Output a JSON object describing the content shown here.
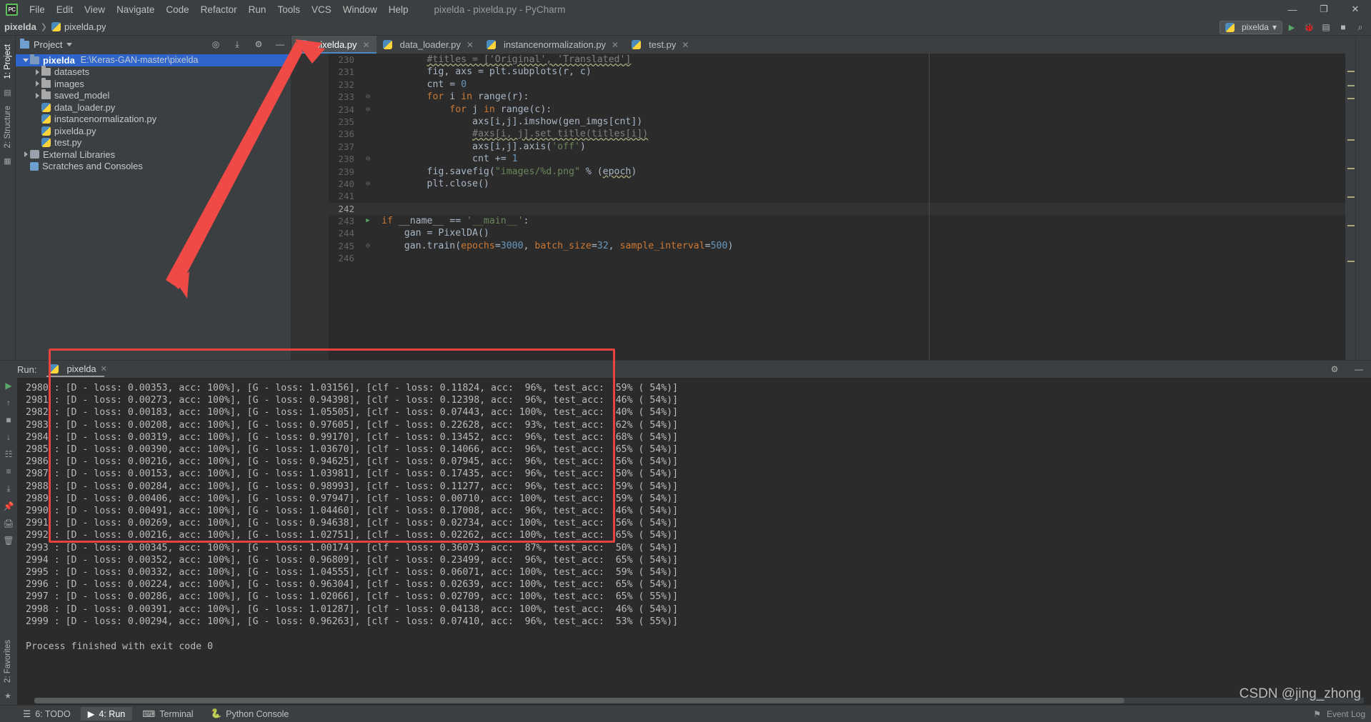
{
  "window": {
    "title": "pixelda - pixelda.py - PyCharm",
    "minimize": "—",
    "maximize": "❐",
    "close": "✕"
  },
  "menu": {
    "items": [
      "File",
      "Edit",
      "View",
      "Navigate",
      "Code",
      "Refactor",
      "Run",
      "Tools",
      "VCS",
      "Window",
      "Help"
    ]
  },
  "breadcrumb": {
    "project": "pixelda",
    "separator": "❯",
    "file": "pixelda.py"
  },
  "toolbar": {
    "run_config": "pixelda",
    "run_icon": "▶",
    "debug_icon": "🐞",
    "coverage_icon": "▤",
    "stop_icon": "■",
    "search_icon": "⌕",
    "dropdown_caret": "▾"
  },
  "project_panel": {
    "title": "Project",
    "settings_icon": "⚙",
    "collapse_icon": "⤓",
    "target_icon": "◎",
    "hide_icon": "—",
    "tree": [
      {
        "name": "pixelda",
        "path": "E:\\Keras-GAN-master\\pixelda",
        "type": "root",
        "depth": 0,
        "expanded": true,
        "selected": true
      },
      {
        "name": "datasets",
        "path": "",
        "type": "folder",
        "depth": 1,
        "expanded": false,
        "selected": false
      },
      {
        "name": "images",
        "path": "",
        "type": "folder",
        "depth": 1,
        "expanded": false,
        "selected": false
      },
      {
        "name": "saved_model",
        "path": "",
        "type": "folder",
        "depth": 1,
        "expanded": false,
        "selected": false
      },
      {
        "name": "data_loader.py",
        "path": "",
        "type": "python",
        "depth": 1,
        "expanded": false,
        "selected": false
      },
      {
        "name": "instancenormalization.py",
        "path": "",
        "type": "python",
        "depth": 1,
        "expanded": false,
        "selected": false
      },
      {
        "name": "pixelda.py",
        "path": "",
        "type": "python",
        "depth": 1,
        "expanded": false,
        "selected": false
      },
      {
        "name": "test.py",
        "path": "",
        "type": "python",
        "depth": 1,
        "expanded": false,
        "selected": false
      },
      {
        "name": "External Libraries",
        "path": "",
        "type": "library",
        "depth": 0,
        "expanded": false,
        "selected": false
      },
      {
        "name": "Scratches and Consoles",
        "path": "",
        "type": "scratch",
        "depth": 0,
        "expanded": false,
        "selected": false
      }
    ]
  },
  "sidebars": {
    "left_top": "1: Project",
    "left_mid": "2: Structure",
    "left_bottom": "2: Favorites",
    "favorites_icon": "★"
  },
  "editor": {
    "tabs": [
      {
        "label": "pixelda.py",
        "active": true,
        "close": "✕"
      },
      {
        "label": "data_loader.py",
        "active": false,
        "close": "✕"
      },
      {
        "label": "instancenormalization.py",
        "active": false,
        "close": "✕"
      },
      {
        "label": "test.py",
        "active": false,
        "close": "✕"
      }
    ],
    "lines": [
      {
        "n": 230,
        "indent": 8,
        "fold": "",
        "run": false,
        "cursor": false,
        "tokens": [
          {
            "t": "#titles = ['Original', 'Translated']",
            "c": "cmt wavy"
          }
        ]
      },
      {
        "n": 231,
        "indent": 8,
        "fold": "",
        "run": false,
        "cursor": false,
        "tokens": [
          {
            "t": "fig, axs = plt.subplots(r, c)",
            "c": "fn"
          }
        ]
      },
      {
        "n": 232,
        "indent": 8,
        "fold": "",
        "run": false,
        "cursor": false,
        "tokens": [
          {
            "t": "cnt = ",
            "c": "fn"
          },
          {
            "t": "0",
            "c": "num"
          }
        ]
      },
      {
        "n": 233,
        "indent": 8,
        "fold": "⊖",
        "run": false,
        "cursor": false,
        "tokens": [
          {
            "t": "for",
            "c": "kw"
          },
          {
            "t": " i ",
            "c": "fn"
          },
          {
            "t": "in",
            "c": "kw"
          },
          {
            "t": " range(r):",
            "c": "fn"
          }
        ]
      },
      {
        "n": 234,
        "indent": 12,
        "fold": "⊖",
        "run": false,
        "cursor": false,
        "tokens": [
          {
            "t": "for",
            "c": "kw"
          },
          {
            "t": " j ",
            "c": "fn"
          },
          {
            "t": "in",
            "c": "kw"
          },
          {
            "t": " range(c):",
            "c": "fn"
          }
        ]
      },
      {
        "n": 235,
        "indent": 16,
        "fold": "",
        "run": false,
        "cursor": false,
        "tokens": [
          {
            "t": "axs[i,j].imshow(gen_imgs[cnt])",
            "c": "fn"
          }
        ]
      },
      {
        "n": 236,
        "indent": 16,
        "fold": "",
        "run": false,
        "cursor": false,
        "tokens": [
          {
            "t": "#axs[i, j].set_title(titles[i])",
            "c": "cmt wavy"
          }
        ]
      },
      {
        "n": 237,
        "indent": 16,
        "fold": "",
        "run": false,
        "cursor": false,
        "tokens": [
          {
            "t": "axs[i,j].axis(",
            "c": "fn"
          },
          {
            "t": "'off'",
            "c": "str"
          },
          {
            "t": ")",
            "c": "fn"
          }
        ]
      },
      {
        "n": 238,
        "indent": 16,
        "fold": "⊖",
        "run": false,
        "cursor": false,
        "tokens": [
          {
            "t": "cnt += ",
            "c": "fn"
          },
          {
            "t": "1",
            "c": "num"
          }
        ]
      },
      {
        "n": 239,
        "indent": 8,
        "fold": "",
        "run": false,
        "cursor": false,
        "tokens": [
          {
            "t": "fig.savefig(",
            "c": "fn"
          },
          {
            "t": "\"images/%d.png\"",
            "c": "str"
          },
          {
            "t": " % (",
            "c": "fn"
          },
          {
            "t": "epoch",
            "c": "fn wavy"
          },
          {
            "t": ")",
            "c": "fn"
          }
        ]
      },
      {
        "n": 240,
        "indent": 8,
        "fold": "⊖",
        "run": false,
        "cursor": false,
        "tokens": [
          {
            "t": "plt.close()",
            "c": "fn"
          }
        ]
      },
      {
        "n": 241,
        "indent": 0,
        "fold": "",
        "run": false,
        "cursor": false,
        "tokens": []
      },
      {
        "n": 242,
        "indent": 0,
        "fold": "",
        "run": false,
        "cursor": true,
        "tokens": []
      },
      {
        "n": 243,
        "indent": 0,
        "fold": "⊖",
        "run": true,
        "cursor": false,
        "tokens": [
          {
            "t": "if",
            "c": "kw"
          },
          {
            "t": " __name__ == ",
            "c": "fn"
          },
          {
            "t": "'__main__'",
            "c": "str"
          },
          {
            "t": ":",
            "c": "fn"
          }
        ]
      },
      {
        "n": 244,
        "indent": 4,
        "fold": "",
        "run": false,
        "cursor": false,
        "tokens": [
          {
            "t": "gan = PixelDA()",
            "c": "fn"
          }
        ]
      },
      {
        "n": 245,
        "indent": 4,
        "fold": "⊖",
        "run": false,
        "cursor": false,
        "tokens": [
          {
            "t": "gan.train(",
            "c": "fn"
          },
          {
            "t": "epochs",
            "c": "param"
          },
          {
            "t": "=",
            "c": "fn"
          },
          {
            "t": "3000",
            "c": "num"
          },
          {
            "t": ", ",
            "c": "fn"
          },
          {
            "t": "batch_size",
            "c": "param"
          },
          {
            "t": "=",
            "c": "fn"
          },
          {
            "t": "32",
            "c": "num"
          },
          {
            "t": ", ",
            "c": "fn"
          },
          {
            "t": "sample_interval",
            "c": "param"
          },
          {
            "t": "=",
            "c": "fn"
          },
          {
            "t": "500",
            "c": "num"
          },
          {
            "t": ")",
            "c": "fn"
          }
        ]
      },
      {
        "n": 246,
        "indent": 0,
        "fold": "",
        "run": false,
        "cursor": false,
        "tokens": []
      }
    ]
  },
  "run_window": {
    "label": "Run:",
    "tab": "pixelda",
    "tab_close": "✕",
    "settings_icon": "⚙",
    "hide_icon": "—",
    "side_icons": [
      "▶",
      "↑",
      "■",
      "↓",
      "☷",
      "≡",
      "⤓",
      "📌",
      "🖨",
      "🗑"
    ],
    "console_lines": [
      "2980 : [D - loss: 0.00353, acc: 100%], [G - loss: 1.03156], [clf - loss: 0.11824, acc:  96%, test_acc:  59% ( 54%)]",
      "2981 : [D - loss: 0.00273, acc: 100%], [G - loss: 0.94398], [clf - loss: 0.12398, acc:  96%, test_acc:  46% ( 54%)]",
      "2982 : [D - loss: 0.00183, acc: 100%], [G - loss: 1.05505], [clf - loss: 0.07443, acc: 100%, test_acc:  40% ( 54%)]",
      "2983 : [D - loss: 0.00208, acc: 100%], [G - loss: 0.97605], [clf - loss: 0.22628, acc:  93%, test_acc:  62% ( 54%)]",
      "2984 : [D - loss: 0.00319, acc: 100%], [G - loss: 0.99170], [clf - loss: 0.13452, acc:  96%, test_acc:  68% ( 54%)]",
      "2985 : [D - loss: 0.00390, acc: 100%], [G - loss: 1.03670], [clf - loss: 0.14066, acc:  96%, test_acc:  65% ( 54%)]",
      "2986 : [D - loss: 0.00216, acc: 100%], [G - loss: 0.94625], [clf - loss: 0.07945, acc:  96%, test_acc:  56% ( 54%)]",
      "2987 : [D - loss: 0.00153, acc: 100%], [G - loss: 1.03981], [clf - loss: 0.17435, acc:  96%, test_acc:  50% ( 54%)]",
      "2988 : [D - loss: 0.00284, acc: 100%], [G - loss: 0.98993], [clf - loss: 0.11277, acc:  96%, test_acc:  59% ( 54%)]",
      "2989 : [D - loss: 0.00406, acc: 100%], [G - loss: 0.97947], [clf - loss: 0.00710, acc: 100%, test_acc:  59% ( 54%)]",
      "2990 : [D - loss: 0.00491, acc: 100%], [G - loss: 1.04460], [clf - loss: 0.17008, acc:  96%, test_acc:  46% ( 54%)]",
      "2991 : [D - loss: 0.00269, acc: 100%], [G - loss: 0.94638], [clf - loss: 0.02734, acc: 100%, test_acc:  56% ( 54%)]",
      "2992 : [D - loss: 0.00216, acc: 100%], [G - loss: 1.02751], [clf - loss: 0.02262, acc: 100%, test_acc:  65% ( 54%)]",
      "2993 : [D - loss: 0.00345, acc: 100%], [G - loss: 1.00174], [clf - loss: 0.36073, acc:  87%, test_acc:  50% ( 54%)]",
      "2994 : [D - loss: 0.00352, acc: 100%], [G - loss: 0.96809], [clf - loss: 0.23499, acc:  96%, test_acc:  65% ( 54%)]",
      "2995 : [D - loss: 0.00332, acc: 100%], [G - loss: 1.04555], [clf - loss: 0.06071, acc: 100%, test_acc:  59% ( 54%)]",
      "2996 : [D - loss: 0.00224, acc: 100%], [G - loss: 0.96304], [clf - loss: 0.02639, acc: 100%, test_acc:  65% ( 54%)]",
      "2997 : [D - loss: 0.00286, acc: 100%], [G - loss: 1.02066], [clf - loss: 0.02709, acc: 100%, test_acc:  65% ( 55%)]",
      "2998 : [D - loss: 0.00391, acc: 100%], [G - loss: 1.01287], [clf - loss: 0.04138, acc: 100%, test_acc:  46% ( 54%)]",
      "2999 : [D - loss: 0.00294, acc: 100%], [G - loss: 0.96263], [clf - loss: 0.07410, acc:  96%, test_acc:  53% ( 55%)]"
    ],
    "exit_message": "Process finished with exit code 0"
  },
  "status_bar": {
    "todo": "6: TODO",
    "todo_icon": "☰",
    "run": "4: Run",
    "run_icon": "▶",
    "terminal": "Terminal",
    "terminal_icon": "⌨",
    "python_console": "Python Console",
    "python_console_icon": "🐍",
    "event_log": "Event Log",
    "event_log_icon": "⚑"
  },
  "watermark": "CSDN @jing_zhong",
  "colors": {
    "accent_blue": "#4a88c7",
    "annotation_red": "#e8433f",
    "selection_blue": "#2f65ca",
    "editor_bg": "#2b2b2b",
    "panel_bg": "#3c3f41",
    "keyword_orange": "#cc7832",
    "string_green": "#6a8759",
    "number_blue": "#6897bb",
    "comment_gray": "#808080",
    "text_gray": "#a9b7c6"
  }
}
